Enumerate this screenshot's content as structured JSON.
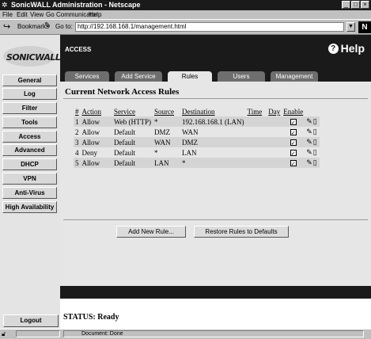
{
  "browser": {
    "title": "SonicWALL Administration - Netscape",
    "menu": [
      "File",
      "Edit",
      "View",
      "Go",
      "Communicator",
      "Help"
    ],
    "bookmarks_label": "Bookmarks",
    "goto_label": "Go to:",
    "url": "http://192.168.168.1/management.html",
    "status_text": "Document: Done"
  },
  "logo": "SONICWALL",
  "nav": [
    "General",
    "Log",
    "Filter",
    "Tools",
    "Access",
    "Advanced",
    "DHCP",
    "VPN",
    "Anti-Virus",
    "High Availability"
  ],
  "logout_label": "Logout",
  "header": {
    "section": "ACCESS",
    "help_label": "Help",
    "tabs": [
      "Services",
      "Add Service",
      "Rules",
      "Users",
      "Management"
    ],
    "active_tab": "Rules"
  },
  "content": {
    "title": "Current Network Access Rules",
    "columns": [
      "#",
      "Action",
      "Service",
      "Source",
      "Destination",
      "Time",
      "Day",
      "Enable"
    ],
    "rows": [
      {
        "num": "1",
        "action": "Allow",
        "service": "Web (HTTP)",
        "source": "*",
        "destination": "192.168.168.1 (LAN)",
        "time": "",
        "day": "",
        "enabled": true
      },
      {
        "num": "2",
        "action": "Allow",
        "service": "Default",
        "source": "DMZ",
        "destination": "WAN",
        "time": "",
        "day": "",
        "enabled": true
      },
      {
        "num": "3",
        "action": "Allow",
        "service": "Default",
        "source": "WAN",
        "destination": "DMZ",
        "time": "",
        "day": "",
        "enabled": true
      },
      {
        "num": "4",
        "action": "Deny",
        "service": "Default",
        "source": "*",
        "destination": "LAN",
        "time": "",
        "day": "",
        "enabled": true
      },
      {
        "num": "5",
        "action": "Allow",
        "service": "Default",
        "source": "LAN",
        "destination": "*",
        "time": "",
        "day": "",
        "enabled": true
      }
    ],
    "add_button": "Add New Rule...",
    "restore_button": "Restore Rules to Defaults",
    "status_label": "STATUS:",
    "status_value": "Ready"
  }
}
